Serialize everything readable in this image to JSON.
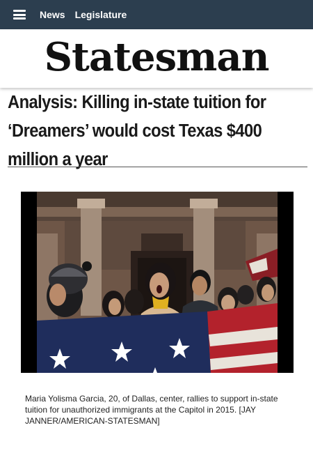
{
  "topbar": {
    "nav": [
      "News",
      "Legislature"
    ]
  },
  "masthead": {
    "logo": "Statesman"
  },
  "article": {
    "headline_lines": [
      "Analysis: Killing in-state tuition for",
      "‘Dreamers’ would cost Texas $400",
      "million a year"
    ],
    "caption": "Maria Yolisma Garcia, 20, of Dallas, center, rallies to support in-state tuition for unauthorized immigrants at the Capitol in 2015. [JAY JANNER/AMERICAN-STATESMAN]"
  },
  "colors": {
    "topbar": "#2c3e4f",
    "headline": "#1a1a1a",
    "flag_blue": "#1f2d5c",
    "flag_red": "#b3222c"
  }
}
